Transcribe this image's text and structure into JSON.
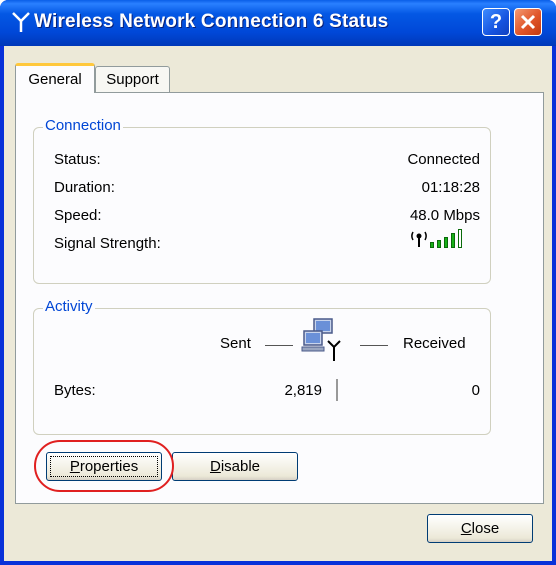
{
  "window": {
    "title": "Wireless Network Connection 6 Status",
    "help_label": "?"
  },
  "tabs": [
    {
      "label": "General",
      "active": true
    },
    {
      "label": "Support",
      "active": false
    }
  ],
  "connection": {
    "legend": "Connection",
    "rows": [
      {
        "label": "Status:",
        "value": "Connected"
      },
      {
        "label": "Duration:",
        "value": "01:18:28"
      },
      {
        "label": "Speed:",
        "value": "48.0 Mbps"
      },
      {
        "label": "Signal Strength:",
        "value": ""
      }
    ],
    "signal_bars": 4,
    "signal_max": 5
  },
  "activity": {
    "legend": "Activity",
    "sent_label": "Sent",
    "received_label": "Received",
    "bytes_label": "Bytes:",
    "bytes_sent": "2,819",
    "bytes_received": "0"
  },
  "buttons": {
    "properties": "Properties",
    "disable": "Disable",
    "close": "Close"
  },
  "colors": {
    "titlebar": "#0054e3",
    "legend_text": "#0046d5",
    "highlight": "#e02020",
    "signal": "#18b018"
  }
}
